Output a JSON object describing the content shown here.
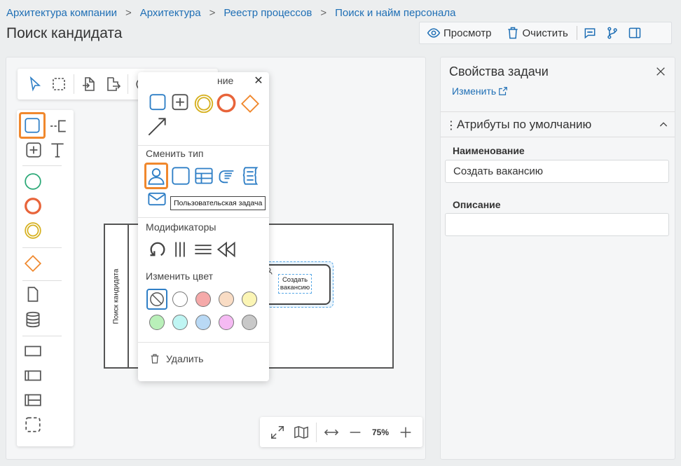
{
  "breadcrumb": [
    "Архитектура компании",
    "Архитектура",
    "Реестр процессов",
    "Поиск и найм персонала"
  ],
  "page_title": "Поиск кандидата",
  "toolbar": {
    "preview_label": "Просмотр",
    "clear_label": "Очистить"
  },
  "popup": {
    "head_partial": "ние",
    "change_type_title": "Сменить тип",
    "modifiers_title": "Модификаторы",
    "change_color_title": "Изменить цвет",
    "delete_label": "Удалить",
    "tooltip": "Пользовательская задача",
    "colors": [
      "#f5a9a9",
      "#f9dcc4",
      "#fbf5b5",
      "#b9f0b9",
      "#bff5f3",
      "#b9d9f5",
      "#f5baf3",
      "#c8c8c8"
    ]
  },
  "diagram": {
    "pool_label": "Поиск кандидата",
    "task_label": "Создать вакансию"
  },
  "zoom": {
    "level": "75%"
  },
  "panel": {
    "title": "Свойства задачи",
    "edit_link": "Изменить",
    "section_title": "Атрибуты по умолчанию",
    "name_label": "Наименование",
    "name_value": "Создать вакансию",
    "description_label": "Описание",
    "description_value": ""
  },
  "colors": {
    "accent": "#f0882d",
    "link": "#1f6fb5",
    "event_start": "#2aa876",
    "event_end": "#e8643a",
    "event_intermediate": "#d6b01e",
    "gateway": "#f0882d",
    "icon_blue": "#2f7fc6"
  }
}
